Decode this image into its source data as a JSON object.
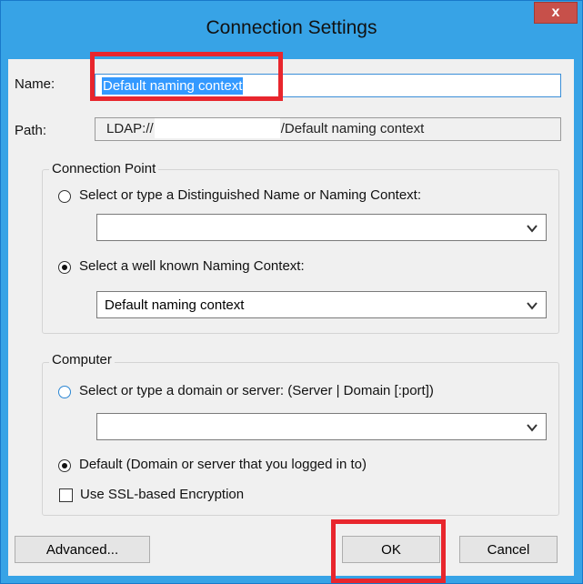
{
  "window": {
    "title": "Connection Settings",
    "close_label": "x"
  },
  "name_field": {
    "label": "Name:",
    "value": "Default naming context"
  },
  "path_field": {
    "label": "Path:",
    "prefix": "LDAP://",
    "suffix": "/Default naming context"
  },
  "connection_point": {
    "title": "Connection Point",
    "option_dn_label": "Select or type a Distinguished Name or Naming Context:",
    "dn_combo_value": "",
    "option_wellknown_label": "Select a well known Naming Context:",
    "wellknown_combo_value": "Default naming context"
  },
  "computer": {
    "title": "Computer",
    "option_server_label": "Select or type a domain or server: (Server | Domain [:port])",
    "server_combo_value": "",
    "option_default_label": "Default (Domain or server that you logged in to)",
    "ssl_label": "Use SSL-based Encryption"
  },
  "buttons": {
    "advanced": "Advanced...",
    "ok": "OK",
    "cancel": "Cancel"
  },
  "colors": {
    "title_bar": "#37a3e6",
    "highlight": "#e8262d",
    "selection": "#3399ff"
  }
}
